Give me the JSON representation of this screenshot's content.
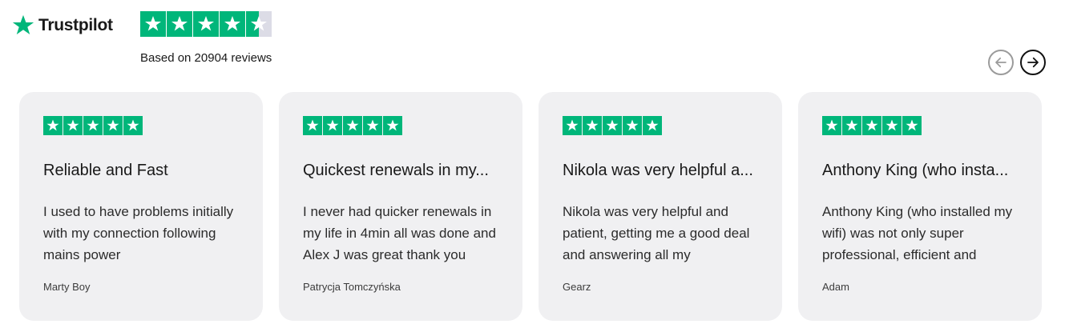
{
  "brand": {
    "name": "Trustpilot",
    "icon": "star-icon",
    "color": "#00b67a"
  },
  "rating": {
    "stars": 4.5,
    "max": 5,
    "summary": "Based on 20904 reviews"
  },
  "nav": {
    "prev_icon": "arrow-left-icon",
    "next_icon": "arrow-right-icon"
  },
  "reviews": [
    {
      "stars": 5,
      "title": "Reliable and Fast",
      "body": "I used to have problems initially with my connection following mains power",
      "author": "Marty Boy"
    },
    {
      "stars": 5,
      "title": "Quickest renewals in my...",
      "body": "I never had quicker renewals in my life in 4min all was done and Alex J was great thank you",
      "author": "Patrycja Tomczyńska"
    },
    {
      "stars": 5,
      "title": "Nikola was very helpful a...",
      "body": "Nikola was very helpful and patient, getting me a good deal and answering all my",
      "author": "Gearz"
    },
    {
      "stars": 5,
      "title": "Anthony King (who insta...",
      "body": "Anthony King (who installed my wifi) was not only super professional, efficient and",
      "author": "Adam"
    }
  ]
}
